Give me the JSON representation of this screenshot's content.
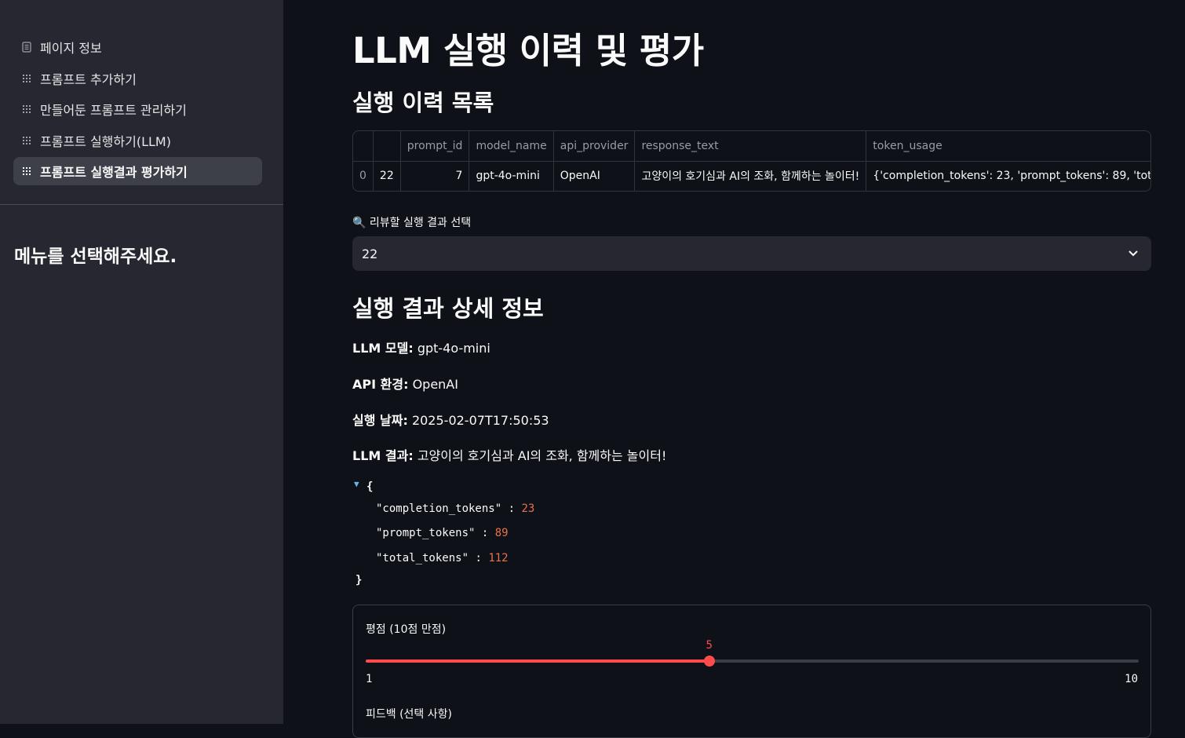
{
  "sidebar": {
    "items": [
      {
        "label": "페이지 정보",
        "icon": "page-icon",
        "active": false
      },
      {
        "label": "프롬프트 추가하기",
        "icon": "grid-icon",
        "active": false
      },
      {
        "label": "만들어둔 프롬프트 관리하기",
        "icon": "grid-icon",
        "active": false
      },
      {
        "label": "프롬프트 실행하기(LLM)",
        "icon": "grid-icon",
        "active": false
      },
      {
        "label": "프롬프트 실행결과 평가하기",
        "icon": "grid-icon",
        "active": true
      }
    ],
    "message": "메뉴를 선택해주세요."
  },
  "main": {
    "title": "LLM 실행 이력 및 평가",
    "history_heading": "실행 이력 목록",
    "table": {
      "columns": [
        "",
        "",
        "prompt_id",
        "model_name",
        "api_provider",
        "response_text",
        "token_usage"
      ],
      "rows": [
        [
          "0",
          "22",
          "7",
          "gpt-4o-mini",
          "OpenAI",
          "고양이의 호기심과 AI의 조화, 함께하는 놀이터!",
          "{'completion_tokens': 23, 'prompt_tokens': 89, 'total_"
        ]
      ]
    },
    "select": {
      "label": "🔍 리뷰할 실행 결과 선택",
      "value": "22"
    },
    "detail_heading": "실행 결과 상세 정보",
    "details": {
      "model_label": "LLM 모델:",
      "model_value": " gpt-4o-mini",
      "api_label": "API 환경:",
      "api_value": " OpenAI",
      "date_label": "실행 날짜:",
      "date_value": " 2025-02-07T17:50:53",
      "result_label": "LLM 결과:",
      "result_value": " 고양이의 호기심과 AI의 조화, 함께하는 놀이터!"
    },
    "json_view": {
      "open": "{",
      "close": "}",
      "entries": [
        {
          "key": "\"completion_tokens\"",
          "value": "23"
        },
        {
          "key": "\"prompt_tokens\"",
          "value": "89"
        },
        {
          "key": "\"total_tokens\"",
          "value": "112"
        }
      ]
    },
    "rating": {
      "label": "평점 (10점 만점)",
      "min": 1,
      "max": 10,
      "value": 5,
      "min_label": "1",
      "max_label": "10",
      "value_label": "5"
    },
    "feedback_label": "피드백 (선택 사항)"
  },
  "colors": {
    "accent": "#ff4b4b",
    "background": "#0e1117",
    "sidebar": "#262730",
    "json_number": "#e8714a"
  }
}
